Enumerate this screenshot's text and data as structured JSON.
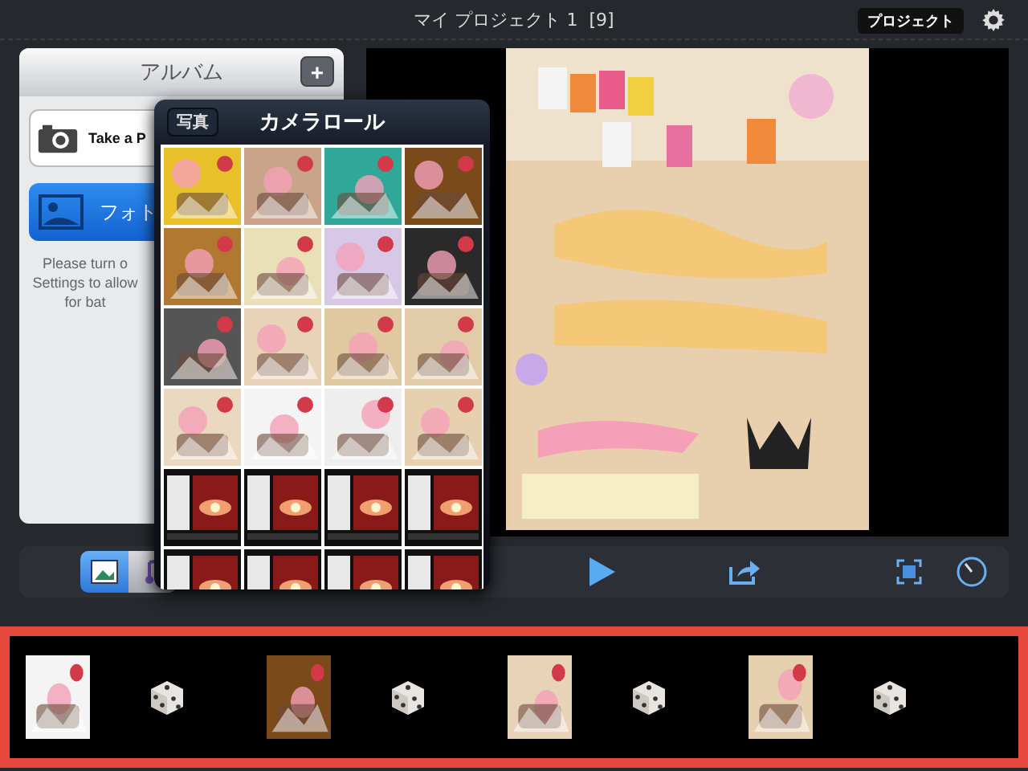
{
  "title_bar": {
    "title": "マイ プロジェクト 1  [9]",
    "project_button": "プロジェクト"
  },
  "album_panel": {
    "title": "アルバム",
    "add_button": "+",
    "take_photo": "Take a P",
    "photos_button": "フォト",
    "notice": [
      "Please turn o",
      "Settings to allow",
      "for bat"
    ]
  },
  "camera_roll": {
    "back_button": "写真",
    "title": "カメラロール",
    "photos": [
      {
        "kind": "picture"
      },
      {
        "kind": "picture"
      },
      {
        "kind": "picture"
      },
      {
        "kind": "picture"
      },
      {
        "kind": "picture"
      },
      {
        "kind": "picture"
      },
      {
        "kind": "picture"
      },
      {
        "kind": "picture"
      },
      {
        "kind": "picture"
      },
      {
        "kind": "picture"
      },
      {
        "kind": "picture"
      },
      {
        "kind": "picture"
      },
      {
        "kind": "picture"
      },
      {
        "kind": "picture"
      },
      {
        "kind": "picture"
      },
      {
        "kind": "picture"
      },
      {
        "kind": "screen"
      },
      {
        "kind": "screen"
      },
      {
        "kind": "screen"
      },
      {
        "kind": "screen"
      },
      {
        "kind": "screen"
      },
      {
        "kind": "screen"
      },
      {
        "kind": "screen"
      },
      {
        "kind": "screen"
      }
    ]
  },
  "preview": {
    "kind": "picture"
  },
  "toolbar": {
    "media_tabs": [
      {
        "kind": "photos",
        "selected": true
      },
      {
        "kind": "music",
        "selected": false
      }
    ]
  },
  "timeline": {
    "clips": [
      {
        "kind": "picture"
      },
      {
        "kind": "transition"
      },
      {
        "kind": "picture"
      },
      {
        "kind": "transition"
      },
      {
        "kind": "picture"
      },
      {
        "kind": "transition"
      },
      {
        "kind": "picture"
      },
      {
        "kind": "transition"
      }
    ]
  }
}
